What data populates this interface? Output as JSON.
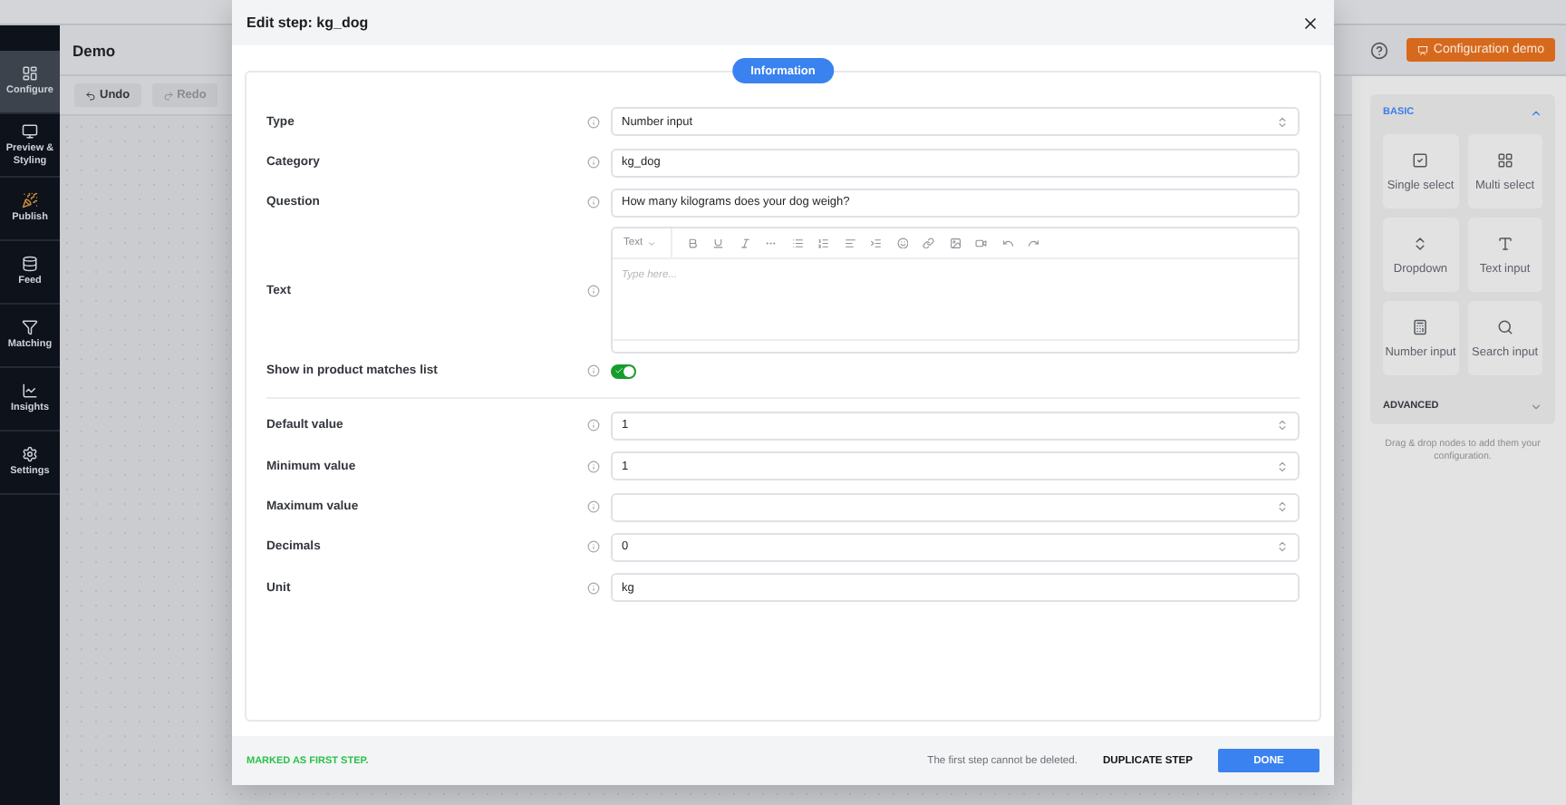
{
  "sidebar": {
    "items": [
      {
        "label": "Configure",
        "selected": true
      },
      {
        "label": "Preview & Styling",
        "selected": false
      },
      {
        "label": "Publish",
        "selected": false
      },
      {
        "label": "Feed",
        "selected": false
      },
      {
        "label": "Matching",
        "selected": false
      },
      {
        "label": "Insights",
        "selected": false
      },
      {
        "label": "Settings",
        "selected": false
      }
    ]
  },
  "editor_header": {
    "title": "Demo",
    "undo": "Undo",
    "redo": "Redo",
    "demo_button": "Configuration demo"
  },
  "palette": {
    "sections": [
      {
        "title": "BASIC",
        "expanded": true,
        "nodes": [
          {
            "label": "Single select"
          },
          {
            "label": "Multi select"
          },
          {
            "label": "Dropdown"
          },
          {
            "label": "Text input"
          },
          {
            "label": "Number input"
          },
          {
            "label": "Search input"
          }
        ]
      },
      {
        "title": "ADVANCED",
        "expanded": false
      }
    ],
    "hint": "Drag & drop nodes to add them your configuration."
  },
  "dialog": {
    "title": "Edit step: kg_dog",
    "tab": {
      "label": "Information",
      "selected": true
    },
    "fields": [
      {
        "label": "Type",
        "kind": "select",
        "value": "Number input"
      },
      {
        "label": "Category",
        "kind": "text",
        "value": "kg_dog"
      },
      {
        "label": "Question",
        "kind": "text",
        "value": "How many kilograms does your dog weigh?"
      },
      {
        "label": "Text",
        "kind": "editor",
        "format_label": "Text",
        "placeholder": "Type here..."
      },
      {
        "label": "Show in product matches list",
        "kind": "toggle",
        "on": true
      },
      {
        "label": "Default value",
        "kind": "number",
        "value": "1"
      },
      {
        "label": "Minimum value",
        "kind": "number",
        "value": "1"
      },
      {
        "label": "Maximum value",
        "kind": "number"
      },
      {
        "label": "Decimals",
        "kind": "number",
        "value": "0"
      },
      {
        "label": "Unit",
        "kind": "text",
        "value": "kg"
      }
    ],
    "footer": {
      "status": "MARKED AS FIRST STEP.",
      "note": "The first step cannot be deleted.",
      "duplicate": "DUPLICATE STEP",
      "done": "DONE"
    }
  }
}
